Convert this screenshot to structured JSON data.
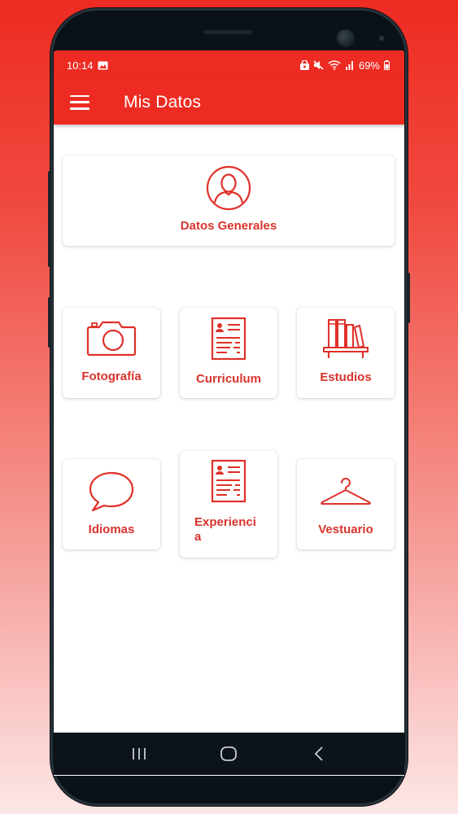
{
  "status_bar": {
    "time": "10:14",
    "battery": "69%",
    "icons": [
      "image-icon",
      "vpn-icon",
      "mute-icon",
      "wifi-icon",
      "signal-icon",
      "battery-icon"
    ]
  },
  "app_bar": {
    "title": "Mis Datos",
    "menu_icon": "hamburger-menu-icon"
  },
  "cards": {
    "datos_generales": {
      "label": "Datos Generales",
      "icon": "person-icon"
    },
    "fotografia": {
      "label": "Fotografía",
      "icon": "camera-icon"
    },
    "curriculum": {
      "label": "Curriculum",
      "icon": "resume-icon"
    },
    "estudios": {
      "label": "Estudios",
      "icon": "books-icon"
    },
    "idiomas": {
      "label": "Idiomas",
      "icon": "speech-bubble-icon"
    },
    "experiencia": {
      "label_line1": "Experienci",
      "label_line2": "a",
      "icon": "resume-icon"
    },
    "vestuario": {
      "label": "Vestuario",
      "icon": "hanger-icon"
    }
  },
  "nav_bar": {
    "buttons": [
      "recents-button",
      "home-button",
      "back-button"
    ]
  },
  "colors": {
    "primary": "#ee2b22",
    "accent_text": "#d8332c",
    "icon": "#e0302a"
  }
}
